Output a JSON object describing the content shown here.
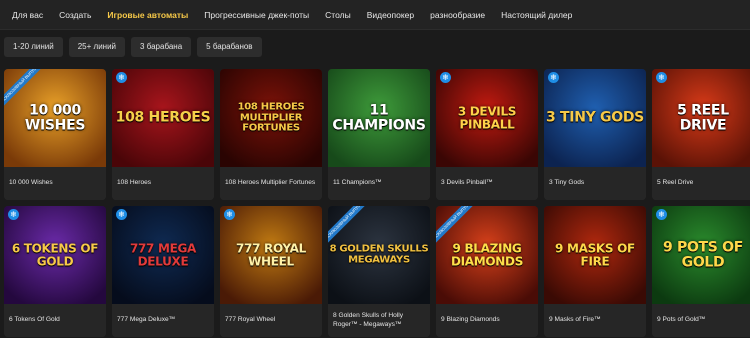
{
  "nav": {
    "tabs": [
      {
        "label": "Для вас"
      },
      {
        "label": "Создать"
      },
      {
        "label": "Игровые автоматы",
        "active": true
      },
      {
        "label": "Прогрессивные джек-поты"
      },
      {
        "label": "Столы"
      },
      {
        "label": "Видеопокер"
      },
      {
        "label": "разнообразие"
      },
      {
        "label": "Настоящий дилер"
      }
    ]
  },
  "filters": [
    {
      "label": "1-20 линий"
    },
    {
      "label": "25+ линий"
    },
    {
      "label": "3 барабана"
    },
    {
      "label": "5 барабанов"
    }
  ],
  "ribbon_text": "ЭКСКЛЮЗИВНЫЙ ВЫПУСК",
  "games": [
    {
      "name": "10 000 Wishes",
      "logo": "10 000 WISHES",
      "bg": "#e8a028",
      "bg2": "#7a3a08",
      "logo_color": "#ffffff",
      "ribbon": true,
      "snow": false
    },
    {
      "name": "108 Heroes",
      "logo": "108 HEROES",
      "bg": "#a8151c",
      "bg2": "#4a0508",
      "logo_color": "#f6d04a",
      "ribbon": false,
      "snow": true
    },
    {
      "name": "108 Heroes Multiplier Fortunes",
      "logo": "108 HEROES MULTIPLIER FORTUNES",
      "bg": "#7b1208",
      "bg2": "#2a0402",
      "logo_color": "#f7c948",
      "ribbon": false,
      "snow": false
    },
    {
      "name": "11 Champions™",
      "logo": "11 CHAMPIONS",
      "bg": "#3e9b3a",
      "bg2": "#174a1a",
      "logo_color": "#ffffff",
      "ribbon": false,
      "snow": false
    },
    {
      "name": "3 Devils Pinball™",
      "logo": "3 DEVILS PINBALL",
      "bg": "#c01a10",
      "bg2": "#3a0604",
      "logo_color": "#ffd24a",
      "ribbon": false,
      "snow": true
    },
    {
      "name": "3 Tiny Gods",
      "logo": "3 TINY GODS",
      "bg": "#1f5fb0",
      "bg2": "#0c2350",
      "logo_color": "#f7c948",
      "ribbon": false,
      "snow": true
    },
    {
      "name": "5 Reel Drive",
      "logo": "5 REEL DRIVE",
      "bg": "#d83a18",
      "bg2": "#5a1206",
      "logo_color": "#ffffff",
      "ribbon": false,
      "snow": true
    },
    {
      "name": "6 Tokens Of Gold",
      "logo": "6 TOKENS OF GOLD",
      "bg": "#6a2aa8",
      "bg2": "#24083e",
      "logo_color": "#f7c948",
      "ribbon": false,
      "snow": true
    },
    {
      "name": "777 Mega Deluxe™",
      "logo": "777 MEGA DELUXE",
      "bg": "#0f2a52",
      "bg2": "#050c1c",
      "logo_color": "#e23a3a",
      "ribbon": false,
      "snow": true
    },
    {
      "name": "777 Royal Wheel",
      "logo": "777 ROYAL WHEEL",
      "bg": "#c07a12",
      "bg2": "#4a1a06",
      "logo_color": "#fff2a8",
      "ribbon": false,
      "snow": true
    },
    {
      "name": "8 Golden Skulls of Holly Roger™ - Megaways™",
      "logo": "8 GOLDEN SKULLS MEGAWAYS",
      "bg": "#2c3440",
      "bg2": "#0c1016",
      "logo_color": "#f0c040",
      "ribbon": true,
      "snow": false
    },
    {
      "name": "9 Blazing Diamonds",
      "logo": "9 BLAZING DIAMONDS",
      "bg": "#d6401a",
      "bg2": "#4a0c06",
      "logo_color": "#ffe04a",
      "ribbon": true,
      "snow": false
    },
    {
      "name": "9 Masks of Fire™",
      "logo": "9 MASKS OF FIRE",
      "bg": "#b0280e",
      "bg2": "#3a0a04",
      "logo_color": "#ffd84a",
      "ribbon": false,
      "snow": false
    },
    {
      "name": "9 Pots of Gold™",
      "logo": "9 POTS OF GOLD",
      "bg": "#2a8a2c",
      "bg2": "#0c3a10",
      "logo_color": "#ffd84a",
      "ribbon": false,
      "snow": true
    }
  ]
}
